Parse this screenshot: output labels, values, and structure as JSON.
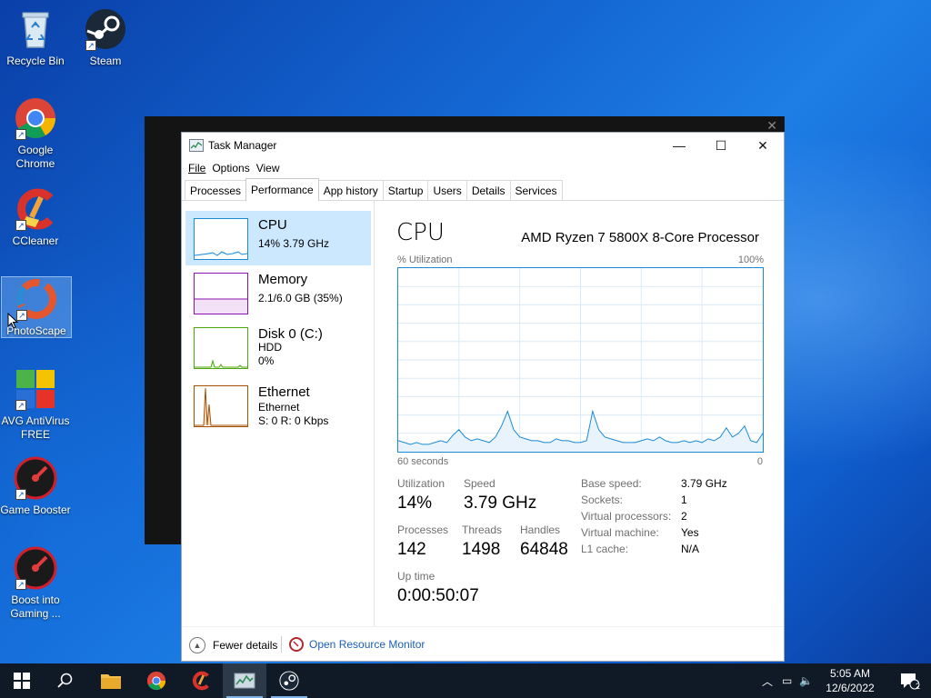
{
  "desktop": {
    "icons": [
      {
        "label": "Recycle Bin"
      },
      {
        "label": "Steam"
      },
      {
        "label": "Google Chrome"
      },
      {
        "label": "CCleaner"
      },
      {
        "label": "PhotoScape"
      },
      {
        "label": "AVG AntiVirus FREE"
      },
      {
        "label": "Game Booster"
      },
      {
        "label": "Boost into Gaming ..."
      }
    ]
  },
  "window": {
    "title": "Task Manager",
    "close_glyph": "✕",
    "max_glyph": "☐",
    "min_glyph": "—"
  },
  "menu": [
    "File",
    "Options",
    "View"
  ],
  "tabs": [
    "Processes",
    "Performance",
    "App history",
    "Startup",
    "Users",
    "Details",
    "Services"
  ],
  "active_tab": "Performance",
  "sidebar": {
    "items": [
      {
        "name": "CPU",
        "sub1": "14% 3.79 GHz",
        "color": "#1a8ad4"
      },
      {
        "name": "Memory",
        "sub1": "2.1/6.0 GB (35%)",
        "color": "#8b12ae"
      },
      {
        "name": "Disk 0 (C:)",
        "sub1": "HDD",
        "sub2": "0%",
        "color": "#4da60c"
      },
      {
        "name": "Ethernet",
        "sub1": "Ethernet",
        "sub2": "S: 0 R: 0 Kbps",
        "color": "#a74f01"
      }
    ]
  },
  "cpu": {
    "title": "CPU",
    "processor": "AMD Ryzen 7 5800X 8-Core Processor",
    "util_label": "% Utilization",
    "max_label": "100%",
    "time_label": "60 seconds",
    "zero_label": "0",
    "stats": {
      "utilization_label": "Utilization",
      "utilization": "14%",
      "speed_label": "Speed",
      "speed": "3.79 GHz",
      "processes_label": "Processes",
      "processes": "142",
      "threads_label": "Threads",
      "threads": "1498",
      "handles_label": "Handles",
      "handles": "64848",
      "uptime_label": "Up time",
      "uptime": "0:00:50:07"
    },
    "details": {
      "base_speed_label": "Base speed:",
      "base_speed": "3.79 GHz",
      "sockets_label": "Sockets:",
      "sockets": "1",
      "vproc_label": "Virtual processors:",
      "vproc": "2",
      "vm_label": "Virtual machine:",
      "vm": "Yes",
      "l1_label": "L1 cache:",
      "l1": "N/A"
    },
    "utilization_history": [
      6,
      5,
      4,
      5,
      4,
      4,
      5,
      6,
      5,
      9,
      12,
      8,
      6,
      7,
      6,
      5,
      8,
      14,
      22,
      12,
      8,
      7,
      6,
      6,
      5,
      5,
      7,
      6,
      6,
      5,
      5,
      6,
      22,
      12,
      8,
      7,
      6,
      5,
      5,
      5,
      6,
      7,
      6,
      8,
      6,
      5,
      5,
      6,
      5,
      6,
      5,
      7,
      6,
      8,
      13,
      8,
      10,
      14,
      6,
      5,
      10
    ]
  },
  "footer": {
    "fewer_details": "Fewer details",
    "open_resmon": "Open Resource Monitor"
  },
  "taskbar": {
    "time": "5:05 AM",
    "date": "12/6/2022",
    "notification_count": "2"
  }
}
